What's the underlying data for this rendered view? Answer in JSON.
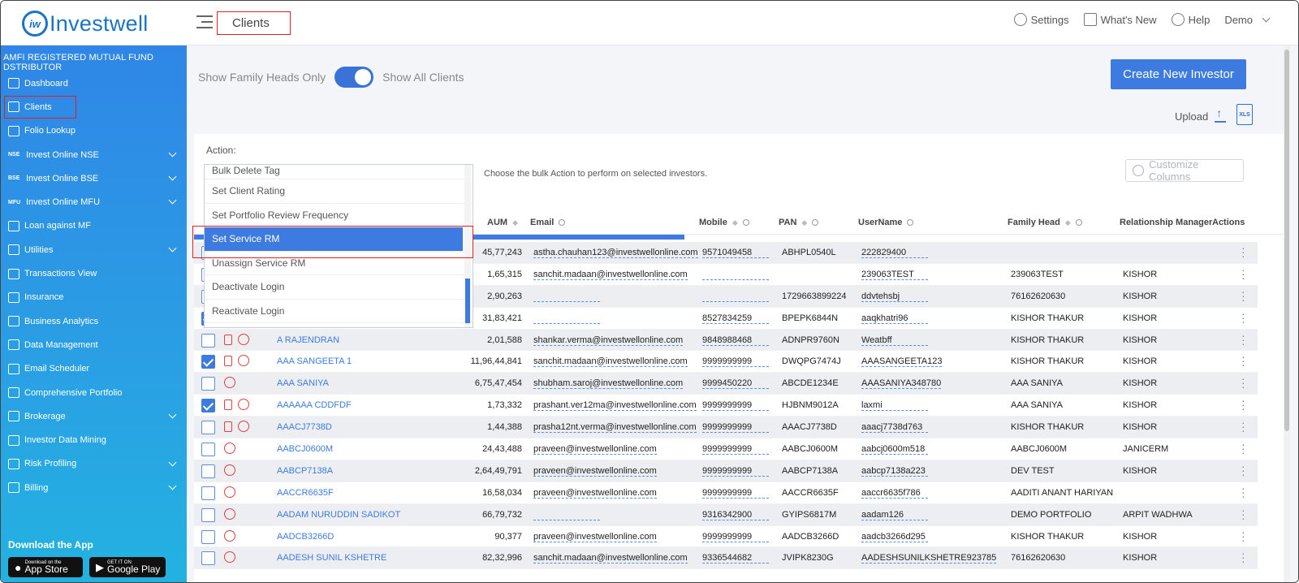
{
  "app": {
    "logo_mark": "iw",
    "logo_text": "Investwell",
    "page_title": "Clients"
  },
  "topnav": {
    "settings": "Settings",
    "whats_new": "What's New",
    "help": "Help",
    "user": "Demo"
  },
  "sidebar": {
    "header": "AMFI REGISTERED MUTUAL FUND DSTRIBUTOR",
    "items": [
      {
        "label": "Dashboard",
        "icon": "home-icon"
      },
      {
        "label": "Clients",
        "icon": "users-icon"
      },
      {
        "label": "Folio Lookup",
        "icon": "folio-icon"
      },
      {
        "label": "Invest Online NSE",
        "tag": "NSE"
      },
      {
        "label": "Invest Online BSE",
        "tag": "BSE"
      },
      {
        "label": "Invest Online MFU",
        "tag": "MFU"
      },
      {
        "label": "Loan against MF",
        "icon": "loan-icon"
      },
      {
        "label": "Utilities",
        "icon": "utilities-icon"
      },
      {
        "label": "Transactions View",
        "icon": "transactions-icon"
      },
      {
        "label": "Insurance",
        "icon": "insurance-icon"
      },
      {
        "label": "Business Analytics",
        "icon": "analytics-icon"
      },
      {
        "label": "Data Management",
        "icon": "data-icon"
      },
      {
        "label": "Email Scheduler",
        "icon": "email-icon"
      },
      {
        "label": "Comprehensive Portfolio",
        "icon": "portfolio-icon"
      },
      {
        "label": "Brokerage",
        "icon": "brokerage-icon"
      },
      {
        "label": "Investor Data Mining",
        "icon": "mining-icon"
      },
      {
        "label": "Risk Profiling",
        "icon": "risk-icon"
      },
      {
        "label": "Billing",
        "icon": "billing-icon"
      }
    ],
    "download_title": "Download the App",
    "appstore_small": "Download on the",
    "appstore": "App Store",
    "googleplay_small": "GET IT ON",
    "googleplay": "Google Play"
  },
  "main": {
    "toggle_left": "Show Family Heads Only",
    "toggle_right": "Show All Clients",
    "create_button": "Create New Investor",
    "upload": "Upload",
    "xls": "XLS",
    "action_label": "Action:",
    "action_hint": "Choose the bulk Action to perform on selected investors.",
    "customize": "Customize Columns"
  },
  "dropdown": {
    "options": [
      "Bulk Delete Tag",
      "Set Client Rating",
      "Set Portfolio Review Frequency",
      "Set Service RM",
      "Unassign Service RM",
      "Deactivate Login",
      "Reactivate Login"
    ],
    "selected": "Set Service RM"
  },
  "table": {
    "headers": {
      "aum": "AUM",
      "email": "Email",
      "mobile": "Mobile",
      "pan": "PAN",
      "username": "UserName",
      "family_head": "Family Head",
      "rm": "Relationship Manager",
      "actions": "Actions"
    },
    "rows": [
      {
        "name": "",
        "aum": "45,77,243",
        "email": "astha.chauhan123@investwellonline.com",
        "mobile": "9571049458",
        "pan": "ABHPL0540L",
        "user": "222829400",
        "fh": "",
        "rm": "",
        "checked": false
      },
      {
        "name": "",
        "aum": "1,65,315",
        "email": "sanchit.madaan@investwellonline.com",
        "mobile": "",
        "pan": "",
        "user": "239063TEST",
        "fh": "239063TEST",
        "rm": "KISHOR",
        "checked": false
      },
      {
        "name": "",
        "aum": "2,90,263",
        "email": "",
        "mobile": "",
        "pan": "1729663899224",
        "user": "ddvtehsbj",
        "fh": "76162620630",
        "rm": "KISHOR",
        "checked": false
      },
      {
        "name": "",
        "aum": "31,83,421",
        "email": "",
        "mobile": "8527834259",
        "pan": "BPEPK6844N",
        "user": "aaqkhatri96",
        "fh": "KISHOR THAKUR",
        "rm": "KISHOR",
        "checked": true
      },
      {
        "name": "A RAJENDRAN",
        "aum": "2,01,588",
        "email": "shankar.verma@investwellonline.com",
        "mobile": "9848988468",
        "pan": "ADNPR9760N",
        "user": "Weatbff",
        "fh": "KISHOR THAKUR",
        "rm": "KISHOR",
        "checked": false
      },
      {
        "name": "AAA SANGEETA 1",
        "aum": "11,96,44,841",
        "email": "sanchit.madaan@investwellonline.com",
        "mobile": "9999999999",
        "pan": "DWQPG7474J",
        "user": "AAASANGEETA123",
        "fh": "KISHOR THAKUR",
        "rm": "KISHOR",
        "checked": true
      },
      {
        "name": "AAA SANIYA",
        "aum": "6,75,47,454",
        "email": "shubham.saroj@investwellonline.com",
        "mobile": "9999450220",
        "pan": "ABCDE1234E",
        "user": "AAASANIYA348780",
        "fh": "AAA SANIYA",
        "rm": "KISHOR",
        "checked": false
      },
      {
        "name": "AAAAAA CDDFDF",
        "aum": "1,73,332",
        "email": "prashant.ver12ma@investwellonline.com",
        "mobile": "9999999999",
        "pan": "HJBNM9012A",
        "user": "laxmi",
        "fh": "AAA SANIYA",
        "rm": "KISHOR",
        "checked": true
      },
      {
        "name": "AAACJ7738D",
        "aum": "1,44,388",
        "email": "prasha12nt.verma@investwellonline.com",
        "mobile": "9999999999",
        "pan": "AAACJ7738D",
        "user": "aaacj7738d763",
        "fh": "KISHOR THAKUR",
        "rm": "KISHOR",
        "checked": false
      },
      {
        "name": "AABCJ0600M",
        "aum": "24,43,488",
        "email": "praveen@investwellonline.com",
        "mobile": "9999999999",
        "pan": "AABCJ0600M",
        "user": "aabcj0600m518",
        "fh": "AABCJ0600M",
        "rm": "JANICERM",
        "checked": false
      },
      {
        "name": "AABCP7138A",
        "aum": "2,64,49,791",
        "email": "praveen@investwellonline.com",
        "mobile": "9999999999",
        "pan": "AABCP7138A",
        "user": "aabcp7138a223",
        "fh": "DEV TEST",
        "rm": "KISHOR",
        "checked": false
      },
      {
        "name": "AACCR6635F",
        "aum": "16,58,034",
        "email": "praveen@investwellonline.com",
        "mobile": "9999999999",
        "pan": "AACCR6635F",
        "user": "aaccr6635f786",
        "fh": "AADITI ANANT HARIYAN",
        "rm": "",
        "checked": false
      },
      {
        "name": "AADAM NURUDDIN SADIKOT",
        "aum": "66,79,732",
        "email": "",
        "mobile": "9316342900",
        "pan": "GYIPS6817M",
        "user": "aadam126",
        "fh": "DEMO PORTFOLIO",
        "rm": "ARPIT WADHWA",
        "checked": false
      },
      {
        "name": "AADCB3266D",
        "aum": "90,377",
        "email": "praveen@investwellonline.com",
        "mobile": "9999999999",
        "pan": "AADCB3266D",
        "user": "aadcb3266d295",
        "fh": "KISHOR THAKUR",
        "rm": "KISHOR",
        "checked": false
      },
      {
        "name": "AADESH SUNIL KSHETRE",
        "aum": "82,32,996",
        "email": "sanchit.madaan@investwellonline.com",
        "mobile": "9336544682",
        "pan": "JVIPK8230G",
        "user": "AADESHSUNILKSHETRE923785",
        "fh": "76162620630",
        "rm": "KISHOR",
        "checked": false
      }
    ]
  }
}
